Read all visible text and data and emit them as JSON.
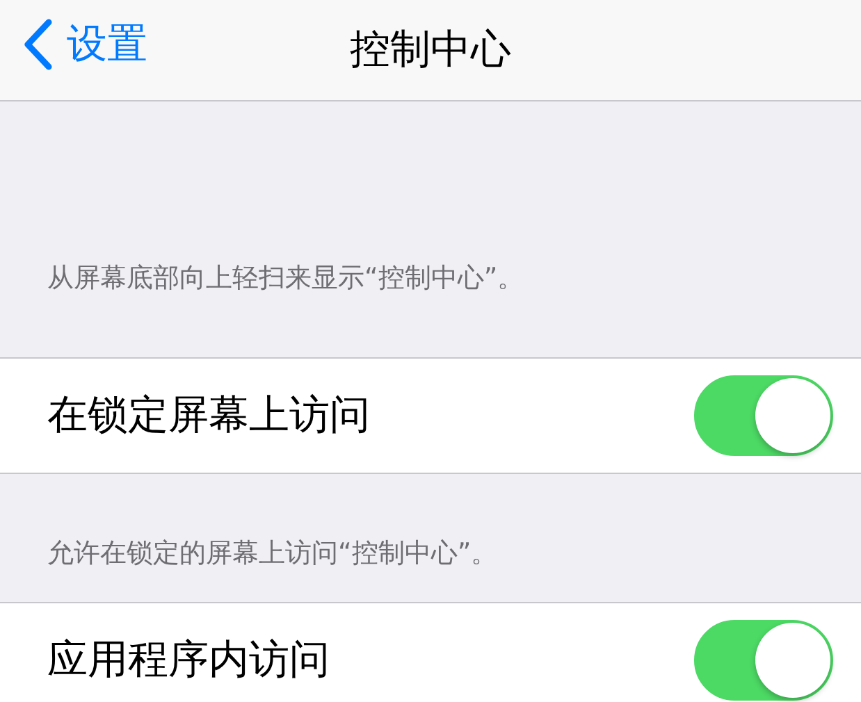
{
  "nav": {
    "back_label": "设置",
    "title": "控制中心"
  },
  "sections": [
    {
      "footer_above": "从屏幕底部向上轻扫来显示“控制中心”。",
      "row": {
        "label": "在锁定屏幕上访问",
        "on": true
      }
    },
    {
      "footer_above": "允许在锁定的屏幕上访问“控制中心”。",
      "row": {
        "label": "应用程序内访问",
        "on": true
      }
    }
  ]
}
